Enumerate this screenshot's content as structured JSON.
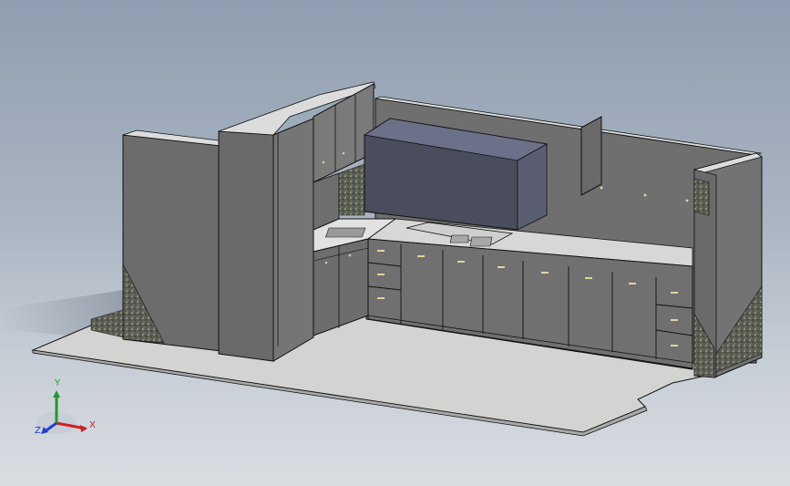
{
  "viewport": {
    "background_top": "#8f9eb0",
    "background_bottom": "#d9dde2"
  },
  "model": {
    "part_colors": {
      "wall": "#6e6e6e",
      "wall_top": "#dcdcdc",
      "cabinet": "#6a6a6a",
      "floor": "#d3d3d1",
      "hood": "#4a4d5c",
      "granite": "#5a5d52"
    }
  },
  "triad": {
    "x_label": "X",
    "y_label": "Y",
    "z_label": "Z",
    "x_color": "#d11f1f",
    "y_color": "#1e9a2e",
    "z_color": "#1f3fd1"
  }
}
